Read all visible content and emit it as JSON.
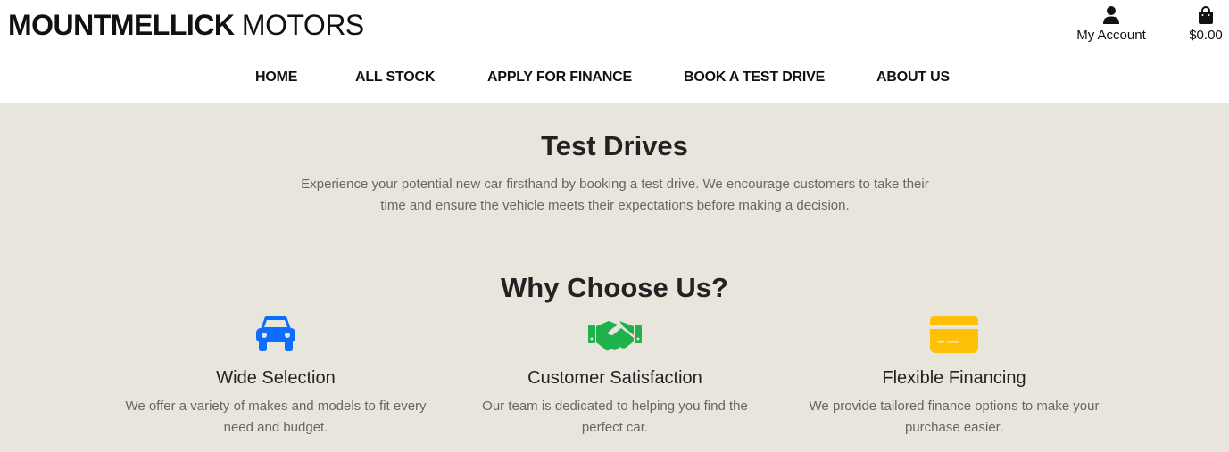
{
  "brand": {
    "bold": "MOUNTMELLICK",
    "regular": "MOTORS"
  },
  "header": {
    "account_label": "My Account",
    "account_icon": "user-icon",
    "bag_total": "$0.00",
    "bag_icon": "shopping-bag-icon"
  },
  "nav": {
    "items": [
      {
        "label": "HOME"
      },
      {
        "label": "ALL STOCK"
      },
      {
        "label": "APPLY FOR FINANCE"
      },
      {
        "label": "BOOK A TEST DRIVE"
      },
      {
        "label": "ABOUT US"
      }
    ]
  },
  "hero": {
    "title": "Test Drives",
    "description": "Experience your potential new car firsthand by booking a test drive. We encourage customers to take their time and ensure the vehicle meets their expectations before making a decision."
  },
  "why": {
    "title": "Why Choose Us?",
    "features": [
      {
        "icon": "car-icon",
        "color": "#0d6efd",
        "title": "Wide Selection",
        "description": "We offer a variety of makes and models to fit every need and budget."
      },
      {
        "icon": "handshake-icon",
        "color": "#1fb14c",
        "title": "Customer Satisfaction",
        "description": "Our team is dedicated to helping you find the perfect car."
      },
      {
        "icon": "credit-card-icon",
        "color": "#ffc107",
        "title": "Flexible Financing",
        "description": "We provide tailored finance options to make your purchase easier."
      }
    ]
  },
  "colors": {
    "background": "#e8e6dc",
    "header_bg": "#ffffff",
    "text": "#222222",
    "muted": "#666666"
  }
}
